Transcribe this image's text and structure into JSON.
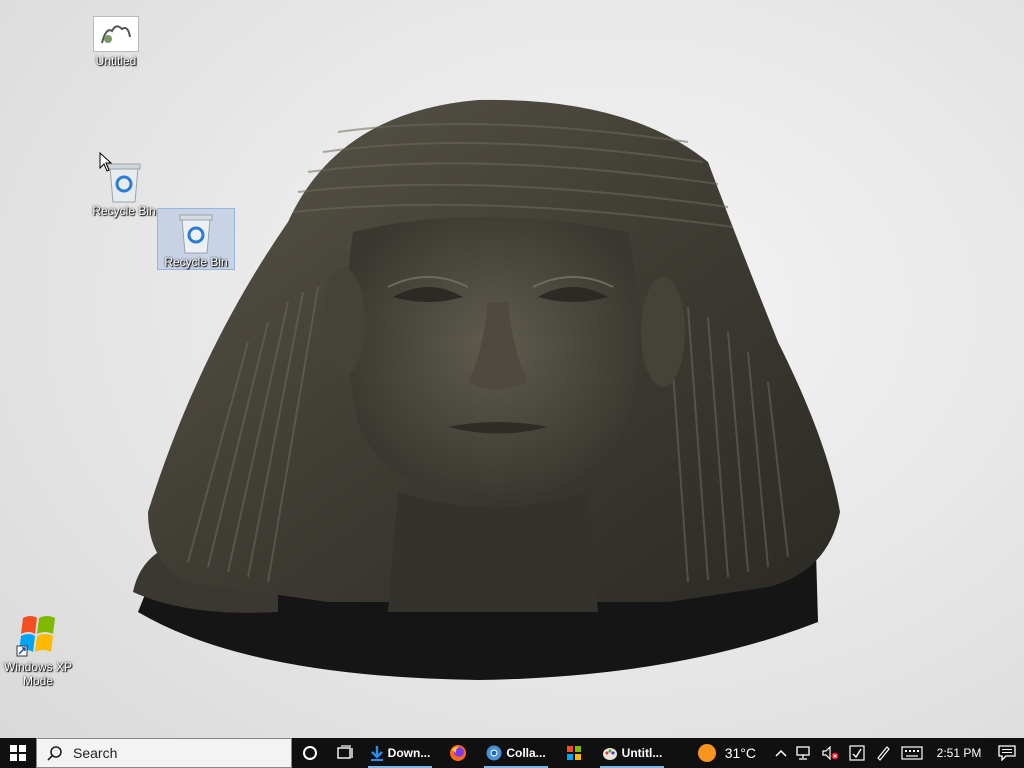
{
  "desktop": {
    "icons": [
      {
        "label": "Untitled",
        "icon": "drawing-file-icon"
      },
      {
        "label": "Recycle Bin",
        "icon": "recycle-bin-icon"
      },
      {
        "label": "Recycle Bin",
        "icon": "recycle-bin-icon"
      },
      {
        "label": "Windows XP Mode",
        "icon": "windows-xp-logo-icon"
      }
    ],
    "wallpaper": "egyptian-sculpture-head"
  },
  "taskbar": {
    "search_placeholder": "Search",
    "apps": [
      {
        "label": "Down...",
        "icon": "download-icon"
      },
      {
        "label": "",
        "icon": "firefox-icon"
      },
      {
        "label": "Colla...",
        "icon": "chrome-icon"
      },
      {
        "label": "",
        "icon": "windows-xp-icon"
      },
      {
        "label": "Untitl...",
        "icon": "paint-icon"
      }
    ],
    "weather": {
      "temp": "31°C",
      "icon": "sun-icon"
    },
    "clock": "2:51 PM"
  },
  "colors": {
    "taskbar_bg": "#101010",
    "active_indicator": "#76b9ed"
  }
}
